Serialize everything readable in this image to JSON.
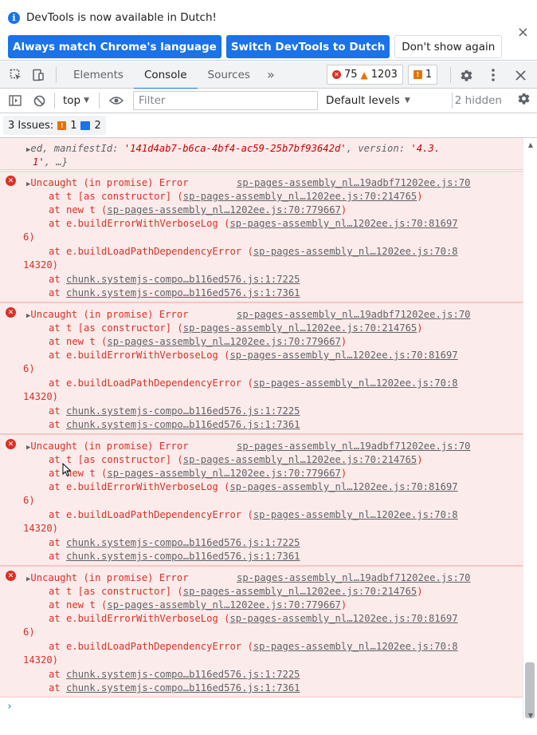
{
  "notice": {
    "text": "DevTools is now available in Dutch!",
    "btn_match": "Always match Chrome's language",
    "btn_switch": "Switch DevTools to Dutch",
    "btn_dismiss": "Don't show again",
    "close": "×"
  },
  "tabs": {
    "elements": "Elements",
    "console": "Console",
    "sources": "Sources",
    "more": "»"
  },
  "counters": {
    "errors": "75",
    "warnings": "1203",
    "issues": "1"
  },
  "toolbar": {
    "context": "top",
    "filter_placeholder": "Filter",
    "levels": "Default levels",
    "hidden": "2 hidden"
  },
  "issues": {
    "label": "3 Issues:",
    "warn_count": "1",
    "info_count": "2"
  },
  "console": {
    "top_line1": "ed, manifestId: ",
    "top_line1_str": "'141d4ab7-b6ca-4bf4-ac59-25b7bf93642d'",
    "top_line1_tail": ", version: ",
    "top_line1_ver": "'4.3.",
    "top_line2_ver": "1'",
    "top_line2_tail": ", …}",
    "errors": [
      {
        "title": "Uncaught (in promise) Error",
        "source": "sp-pages-assembly_nl…19adbf71202ee.js:70",
        "l1": "at t [as constructor] (",
        "l1_link": "sp-pages-assembly_nl…1202ee.js:70:214765",
        "l2": "at new t (",
        "l2_link": "sp-pages-assembly_nl…1202ee.js:70:779667",
        "l3": "at e.buildErrorWithVerboseLog (",
        "l3_link": "sp-pages-assembly_nl…1202ee.js:70:81697",
        "l3b": "6)",
        "l4": "at e.buildLoadPathDependencyError (",
        "l4_link": "sp-pages-assembly_nl…1202ee.js:70:8",
        "l4b": "14320)",
        "l5": "at ",
        "l5_link": "chunk.systemjs-compo…b116ed576.js:1:7225",
        "l6": "at ",
        "l6_link": "chunk.systemjs-compo…b116ed576.js:1:7361"
      }
    ],
    "prompt": "›"
  }
}
